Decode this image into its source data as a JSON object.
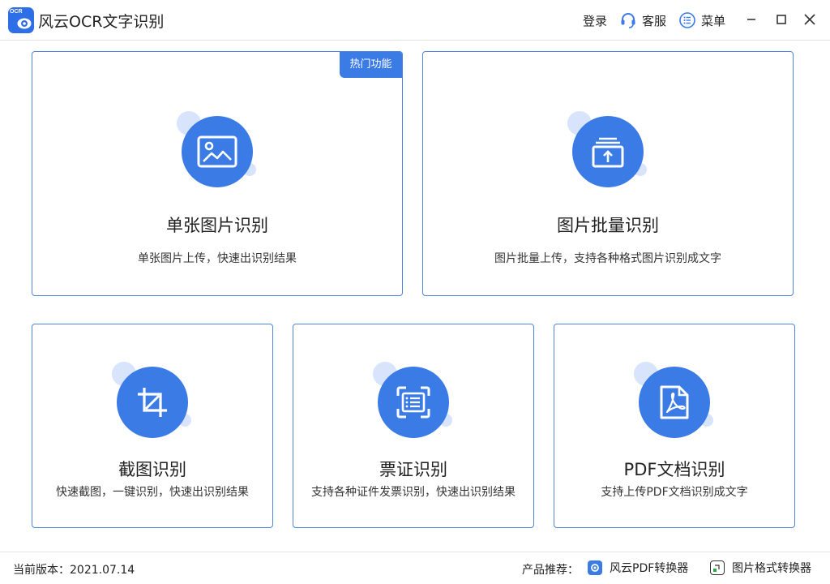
{
  "app": {
    "title": "风云OCR文字识别",
    "logo_text": "OCR"
  },
  "titlebar": {
    "login_label": "登录",
    "service_label": "客服",
    "menu_label": "菜单"
  },
  "cards": [
    {
      "title": "单张图片识别",
      "desc": "单张图片上传，快速出识别结果",
      "icon": "image-icon",
      "badge": "热门功能"
    },
    {
      "title": "图片批量识别",
      "desc": "图片批量上传，支持各种格式图片识别成文字",
      "icon": "batch-upload-icon"
    },
    {
      "title": "截图识别",
      "desc": "快速截图，一键识别，快速出识别结果",
      "icon": "crop-icon"
    },
    {
      "title": "票证识别",
      "desc": "支持各种证件发票识别，快速出识别结果",
      "icon": "scan-document-icon"
    },
    {
      "title": "PDF文档识别",
      "desc": "支持上传PDF文档识别成文字",
      "icon": "pdf-icon"
    }
  ],
  "footer": {
    "version": "当前版本：2021.07.14",
    "recommend_label": "产品推荐：",
    "products": [
      {
        "label": "风云PDF转换器",
        "icon": "pdf-converter-icon"
      },
      {
        "label": "图片格式转换器",
        "icon": "image-converter-icon"
      }
    ]
  },
  "colors": {
    "accent": "#3b7be6",
    "accent_light": "#d7e4fb",
    "border": "#4b86e0"
  }
}
